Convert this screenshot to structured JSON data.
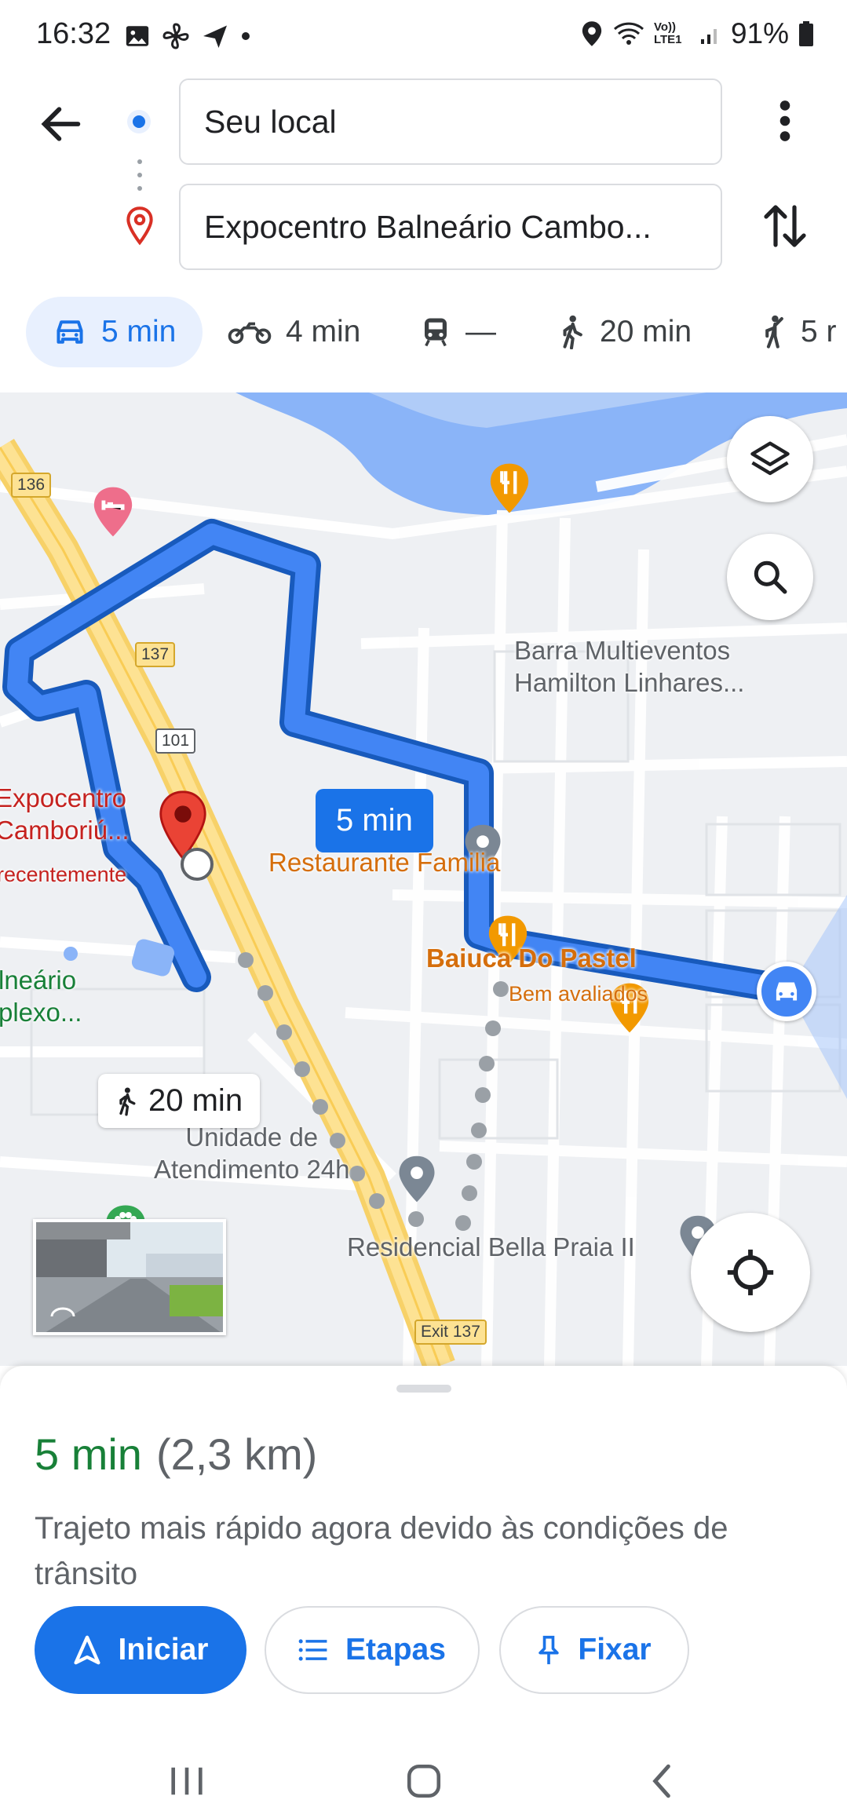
{
  "status_bar": {
    "time": "16:32",
    "battery": "91%",
    "network": "Vo)) LTE1"
  },
  "directions": {
    "origin": "Seu local",
    "destination": "Expocentro Balneário Cambo..."
  },
  "modes": [
    {
      "name": "car",
      "label": "5 min",
      "active": true
    },
    {
      "name": "motorcycle",
      "label": "4 min"
    },
    {
      "name": "transit",
      "label": "—"
    },
    {
      "name": "walk",
      "label": "20 min"
    },
    {
      "name": "cycle",
      "label": "5 r"
    }
  ],
  "map": {
    "route_time": "5 min",
    "walk_time": "20 min",
    "labels": {
      "barra": "Barra Multieventos\nHamilton Linhares...",
      "restaurante": "Restaurante Familia",
      "baiuca": "Baiuca Do Pastel",
      "baiuca_sub": "Bem avaliados",
      "expocentro": "Expocentro\nCamboriú...",
      "expocentro_sub": "recentemente",
      "balneario": "lneário\nplexo...",
      "unidade": "Unidade de\nAtendimento 24h",
      "residencial": "Residencial Bella Praia II"
    },
    "shields": {
      "r136": "136",
      "r137": "137",
      "r101": "101",
      "exit": "Exit 137"
    }
  },
  "sheet": {
    "duration": "5 min",
    "distance": "(2,3 km)",
    "reason": "Trajeto mais rápido agora devido às condições de trânsito",
    "start_label": "Iniciar",
    "steps_label": "Etapas",
    "pin_label": "Fixar"
  },
  "colors": {
    "accent": "#1a73e8",
    "duration_green": "#188038",
    "route": "#1a73e8"
  }
}
